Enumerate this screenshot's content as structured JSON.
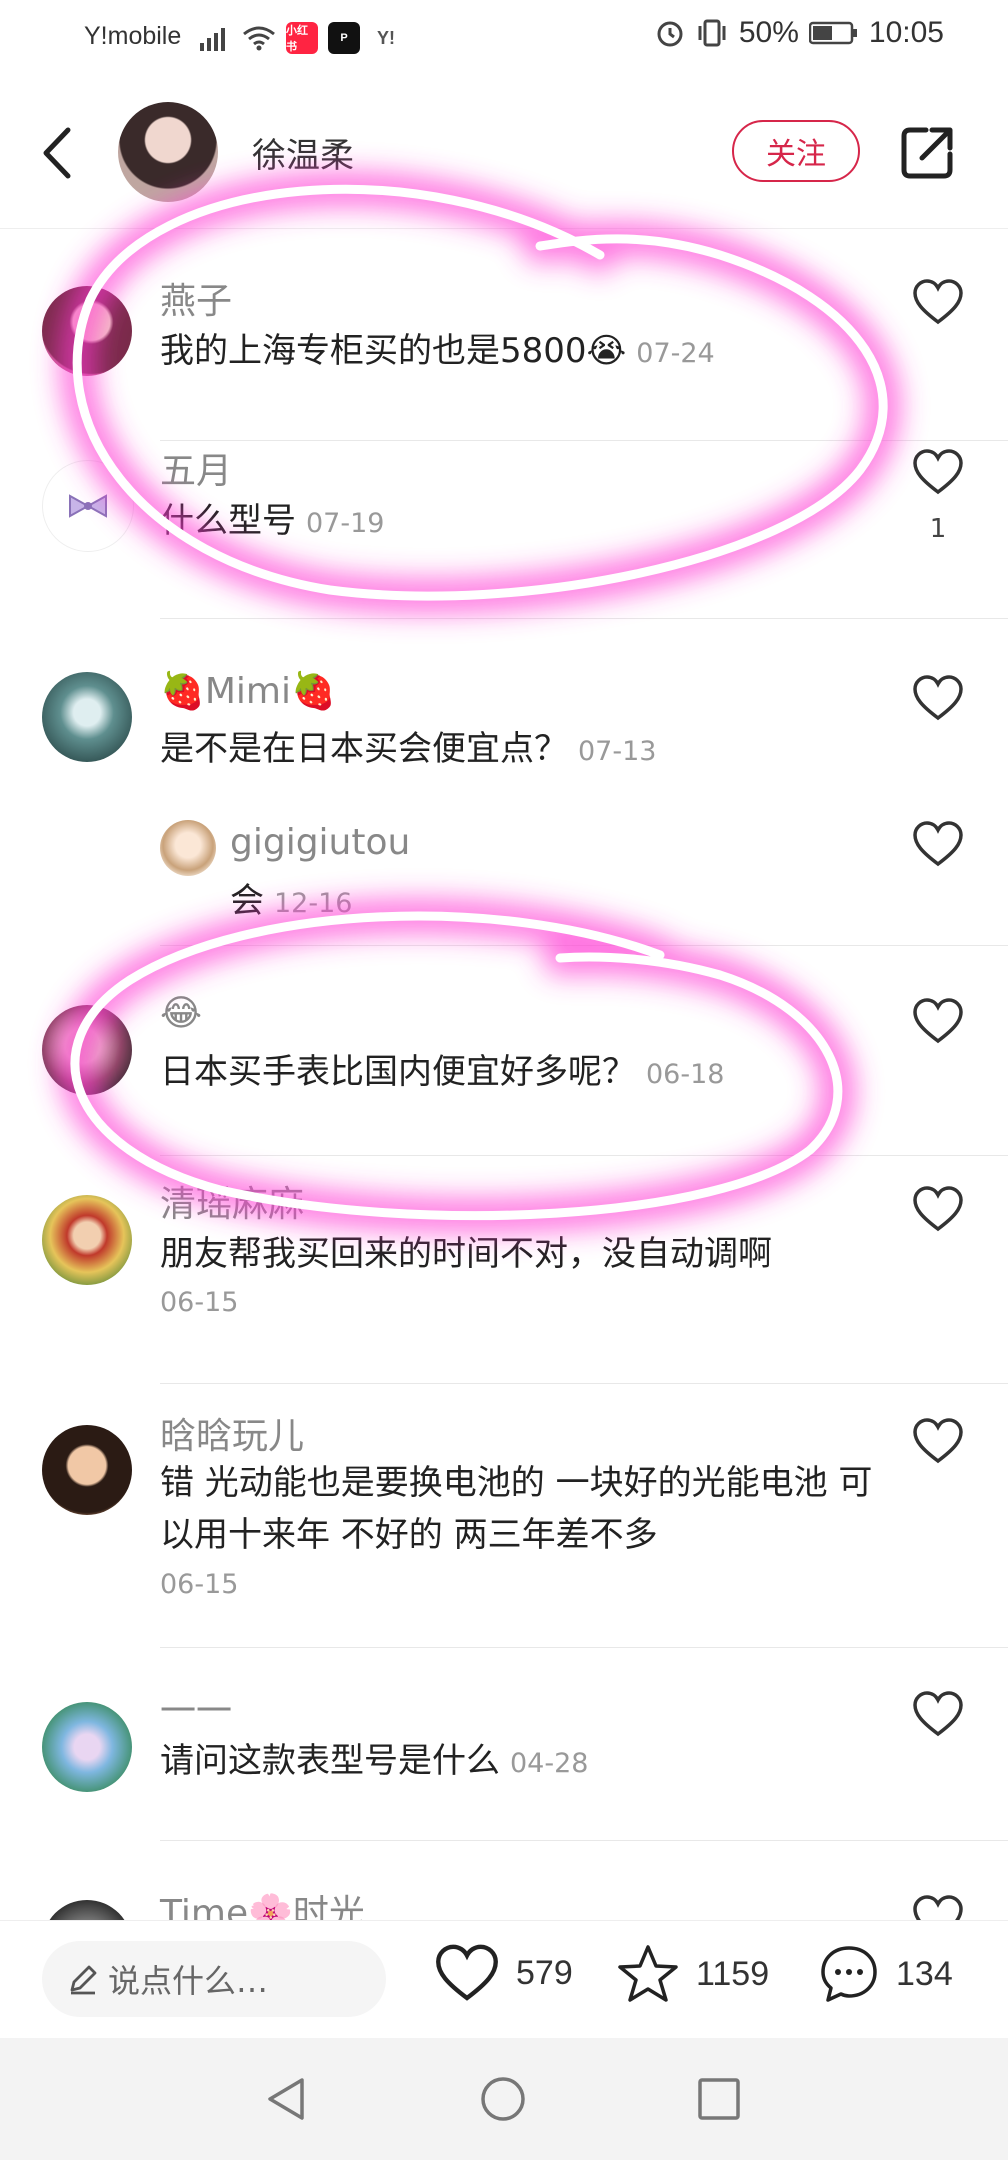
{
  "status_bar": {
    "carrier": "Y!mobile",
    "app_badges": [
      {
        "icon": "xiaohongshu-icon",
        "label": "小红书",
        "color": "#ff2442"
      },
      {
        "icon": "pinduoduo-icon",
        "label": "P",
        "color": "#111111"
      },
      {
        "icon": "yahoo-icon",
        "label": "Y!",
        "color": "#555555"
      }
    ],
    "battery": "50%",
    "time": "10:05"
  },
  "header": {
    "author_name": "徐温柔",
    "follow_label": "关注"
  },
  "comments": [
    {
      "name": "燕子",
      "text": "我的上海专柜买的也是5800😭",
      "date": "07-24",
      "likes": ""
    },
    {
      "name": "五月",
      "text": "什么型号",
      "date": "07-19",
      "likes": "1"
    },
    {
      "name": "🍓Mimi🍓",
      "text": "是不是在日本买会便宜点？",
      "date": "07-13",
      "likes": ""
    },
    {
      "name": "gigigiutou",
      "text": "会",
      "date": "12-16",
      "likes": "",
      "reply": true
    },
    {
      "name": "😂",
      "text": "日本买手表比国内便宜好多呢？",
      "date": "06-18",
      "likes": ""
    },
    {
      "name": "清瑶麻麻",
      "text": "朋友帮我买回来的时间不对，没自动调啊",
      "date": "06-15",
      "likes": ""
    },
    {
      "name": "晗晗玩儿",
      "text": "错 光动能也是要换电池的 一块好的光能电池 可以用十来年 不好的 两三年差不多",
      "date": "06-15",
      "likes": ""
    },
    {
      "name": "一一",
      "text": "请问这款表型号是什么",
      "date": "04-28",
      "likes": ""
    },
    {
      "name": "Time🌸时光",
      "text": "",
      "date": "",
      "likes": ""
    }
  ],
  "bottom_bar": {
    "input_placeholder": "说点什么…",
    "likes": "579",
    "favorites": "1159",
    "comments": "134"
  },
  "colors": {
    "accent": "#d6264a",
    "scribble_glow": "#ff3bd4"
  }
}
